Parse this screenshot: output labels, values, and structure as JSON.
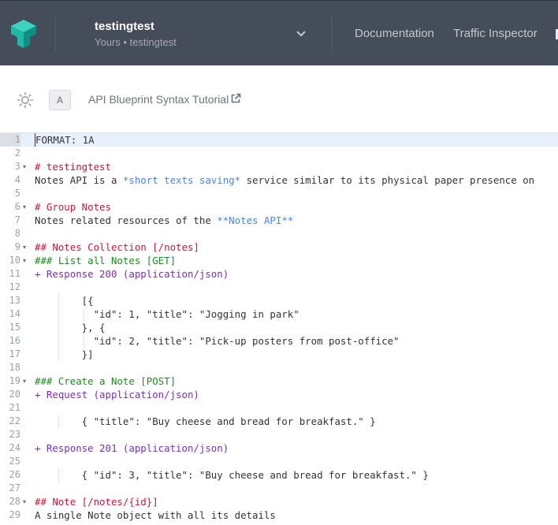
{
  "header": {
    "project_name": "testingtest",
    "project_sub": "Yours • testingtest",
    "nav": [
      {
        "label": "Documentation"
      },
      {
        "label": "Traffic Inspector"
      }
    ],
    "colors": {
      "bar": "#464d5a",
      "logo_primary": "#1fb8a6",
      "logo_secondary": "#0e8f84"
    }
  },
  "toolbar": {
    "badge": "A",
    "tutorial_label": "API Blueprint Syntax Tutorial",
    "icons": [
      "sun-icon",
      "external-link-icon"
    ]
  },
  "editor": {
    "lines": [
      {
        "n": "1",
        "fold": "",
        "parts": [
          {
            "t": "FORMAT: 1A",
            "c": ""
          }
        ]
      },
      {
        "n": "2",
        "fold": "",
        "parts": []
      },
      {
        "n": "3",
        "fold": "▾",
        "parts": [
          {
            "t": "# testingtest",
            "c": "c-red"
          }
        ]
      },
      {
        "n": "4",
        "fold": "",
        "parts": [
          {
            "t": "Notes API is a ",
            "c": ""
          },
          {
            "t": "*short texts saving*",
            "c": "c-blue"
          },
          {
            "t": " service similar to its physical paper presence on",
            "c": ""
          }
        ]
      },
      {
        "n": "5",
        "fold": "",
        "parts": []
      },
      {
        "n": "6",
        "fold": "▾",
        "parts": [
          {
            "t": "# Group Notes",
            "c": "c-red"
          }
        ]
      },
      {
        "n": "7",
        "fold": "",
        "parts": [
          {
            "t": "Notes related resources of the ",
            "c": ""
          },
          {
            "t": "**Notes API**",
            "c": "c-blue"
          }
        ]
      },
      {
        "n": "8",
        "fold": "",
        "parts": []
      },
      {
        "n": "9",
        "fold": "▾",
        "parts": [
          {
            "t": "## Notes Collection [/notes]",
            "c": "c-red"
          }
        ]
      },
      {
        "n": "10",
        "fold": "▾",
        "parts": [
          {
            "t": "### List all Notes [GET]",
            "c": "c-green"
          }
        ]
      },
      {
        "n": "11",
        "fold": "",
        "parts": [
          {
            "t": "+ Response 200 (application/json)",
            "c": "c-purple"
          }
        ]
      },
      {
        "n": "12",
        "fold": "",
        "parts": []
      },
      {
        "n": "13",
        "fold": "",
        "parts": [
          {
            "t": "        [{",
            "c": ""
          }
        ]
      },
      {
        "n": "14",
        "fold": "",
        "parts": [
          {
            "t": "          \"id\": 1, \"title\": \"Jogging in park\"",
            "c": ""
          }
        ]
      },
      {
        "n": "15",
        "fold": "",
        "parts": [
          {
            "t": "        }, {",
            "c": ""
          }
        ]
      },
      {
        "n": "16",
        "fold": "",
        "parts": [
          {
            "t": "          \"id\": 2, \"title\": \"Pick-up posters from post-office\"",
            "c": ""
          }
        ]
      },
      {
        "n": "17",
        "fold": "",
        "parts": [
          {
            "t": "        }]",
            "c": ""
          }
        ]
      },
      {
        "n": "18",
        "fold": "",
        "parts": []
      },
      {
        "n": "19",
        "fold": "▾",
        "parts": [
          {
            "t": "### Create a Note [POST]",
            "c": "c-green"
          }
        ]
      },
      {
        "n": "20",
        "fold": "",
        "parts": [
          {
            "t": "+ Request (application/json)",
            "c": "c-purple"
          }
        ]
      },
      {
        "n": "21",
        "fold": "",
        "parts": []
      },
      {
        "n": "22",
        "fold": "",
        "parts": [
          {
            "t": "        { \"title\": \"Buy cheese and bread for breakfast.\" }",
            "c": ""
          }
        ]
      },
      {
        "n": "23",
        "fold": "",
        "parts": []
      },
      {
        "n": "24",
        "fold": "",
        "parts": [
          {
            "t": "+ Response 201 (application/json)",
            "c": "c-purple"
          }
        ]
      },
      {
        "n": "25",
        "fold": "",
        "parts": []
      },
      {
        "n": "26",
        "fold": "",
        "parts": [
          {
            "t": "        { \"id\": 3, \"title\": \"Buy cheese and bread for breakfast.\" }",
            "c": ""
          }
        ]
      },
      {
        "n": "27",
        "fold": "",
        "parts": []
      },
      {
        "n": "28",
        "fold": "▾",
        "parts": [
          {
            "t": "## Note [/notes/{id}]",
            "c": "c-red"
          }
        ]
      },
      {
        "n": "29",
        "fold": "",
        "parts": [
          {
            "t": "A single Note object with all its details",
            "c": ""
          }
        ]
      }
    ]
  }
}
